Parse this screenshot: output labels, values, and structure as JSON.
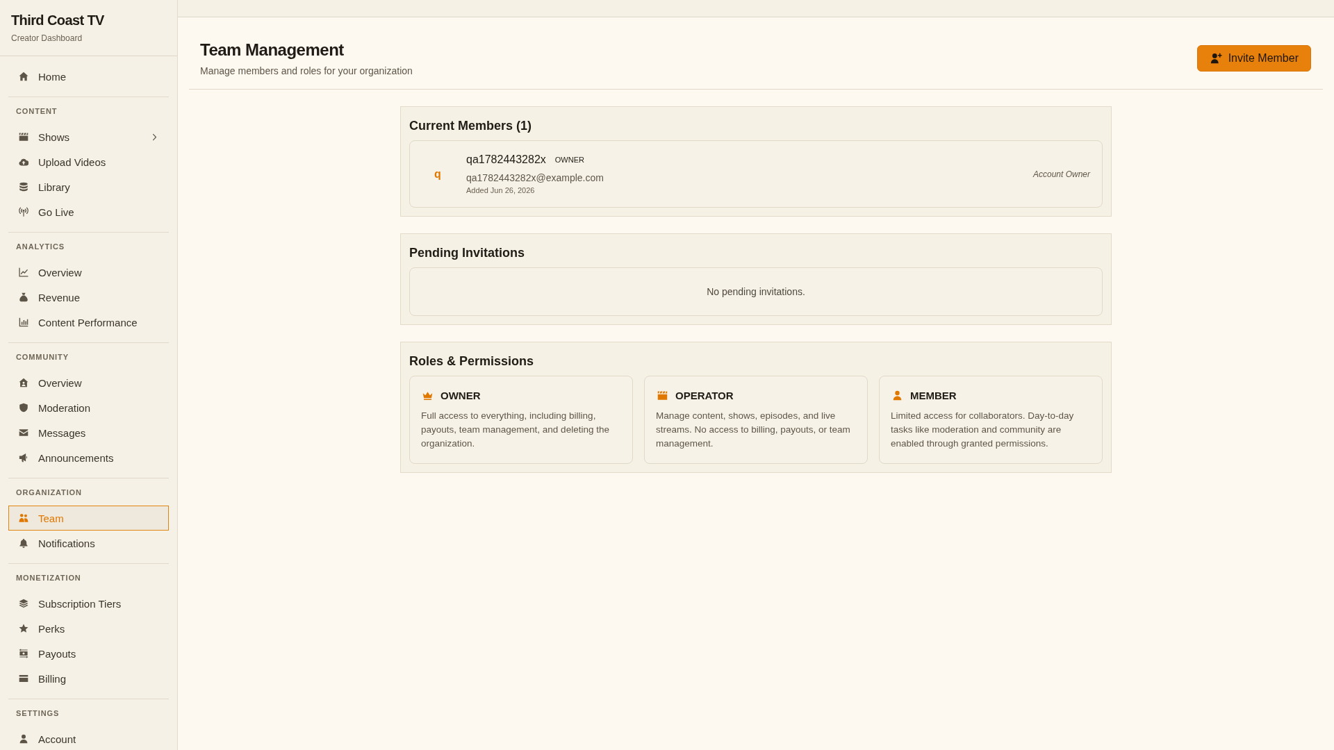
{
  "sidebar": {
    "brand": "Third Coast TV",
    "tagline": "Creator Dashboard",
    "sections": [
      {
        "items": [
          {
            "label": "Home",
            "selected": false
          }
        ]
      },
      {
        "title": "CONTENT",
        "items": [
          {
            "label": "Shows",
            "selected": false,
            "expanded": false
          },
          {
            "label": "Upload Videos",
            "selected": false
          },
          {
            "label": "Library",
            "selected": false
          },
          {
            "label": "Go Live",
            "selected": false
          }
        ]
      },
      {
        "title": "ANALYTICS",
        "items": [
          {
            "label": "Overview",
            "selected": false
          },
          {
            "label": "Revenue",
            "selected": false
          },
          {
            "label": "Content Performance",
            "selected": false
          }
        ]
      },
      {
        "title": "COMMUNITY",
        "items": [
          {
            "label": "Overview",
            "selected": false
          },
          {
            "label": "Moderation",
            "selected": false
          },
          {
            "label": "Messages",
            "selected": false
          },
          {
            "label": "Announcements",
            "selected": false
          }
        ]
      },
      {
        "title": "ORGANIZATION",
        "items": [
          {
            "label": "Team",
            "selected": true
          },
          {
            "label": "Notifications",
            "selected": false
          }
        ]
      },
      {
        "title": "MONETIZATION",
        "items": [
          {
            "label": "Subscription Tiers",
            "selected": false
          },
          {
            "label": "Perks",
            "selected": false
          },
          {
            "label": "Payouts",
            "selected": false
          },
          {
            "label": "Billing",
            "selected": false
          }
        ]
      },
      {
        "title": "SETTINGS",
        "items": [
          {
            "label": "Account",
            "selected": false
          }
        ]
      }
    ]
  },
  "page_header": {
    "title": "Team Management",
    "subtitle": "Manage members and roles for your organization",
    "invite_button": "Invite Member"
  },
  "current_members": {
    "title": "Current Members (1)",
    "members": [
      {
        "initial": "q",
        "name": "qa1782443282x",
        "role": "OWNER",
        "email": "qa1782443282x@example.com",
        "added": "Added Jun 26, 2026",
        "status": "Account Owner"
      }
    ]
  },
  "pending_invitations": {
    "title": "Pending Invitations",
    "empty_message": "No pending invitations."
  },
  "roles_permissions": {
    "title": "Roles & Permissions",
    "roles": [
      {
        "name": "OWNER",
        "description": "Full access to everything, including billing, payouts, team management, and deleting the organization."
      },
      {
        "name": "OPERATOR",
        "description": "Manage content, shows, episodes, and live streams. No access to billing, payouts, or team management."
      },
      {
        "name": "MEMBER",
        "description": "Limited access for collaborators. Day-to-day tasks like moderation and community are enabled through granted permissions."
      }
    ]
  }
}
